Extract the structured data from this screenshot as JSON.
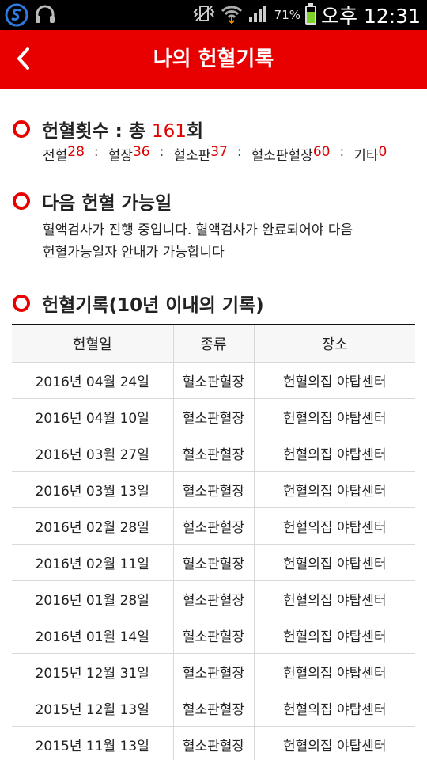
{
  "status_bar": {
    "battery_percent": "71%",
    "battery_level": 0.71,
    "time": "오후 12:31",
    "icons": [
      "s-logo-icon",
      "headset-icon",
      "vibrate-icon",
      "wifi-icon",
      "signal-icon",
      "battery-icon"
    ]
  },
  "header": {
    "title": "나의 헌혈기록",
    "back_icon": "chevron-left-icon",
    "background": "#e80000"
  },
  "summary": {
    "label": "헌혈횟수 : 총 ",
    "total": "161",
    "unit": "회",
    "stats": [
      {
        "label": "전혈",
        "value": "28"
      },
      {
        "label": "혈장",
        "value": "36"
      },
      {
        "label": "혈소판",
        "value": "37"
      },
      {
        "label": "혈소판혈장",
        "value": "60"
      },
      {
        "label": "기타",
        "value": "0"
      }
    ],
    "separator": ":"
  },
  "next": {
    "title": "다음 헌혈 가능일",
    "line1": "혈액검사가 진행 중입니다. 혈액검사가 완료되어야 다음",
    "line2": "헌혈가능일자 안내가 가능합니다"
  },
  "records": {
    "title": "헌혈기록(10년 이내의 기록)",
    "headers": [
      "헌혈일",
      "종류",
      "장소"
    ],
    "rows": [
      [
        "2016년 04월 24일",
        "혈소판혈장",
        "헌혈의집 야탑센터"
      ],
      [
        "2016년 04월 10일",
        "혈소판혈장",
        "헌혈의집 야탑센터"
      ],
      [
        "2016년 03월 27일",
        "혈소판혈장",
        "헌혈의집 야탑센터"
      ],
      [
        "2016년 03월 13일",
        "혈소판혈장",
        "헌혈의집 야탑센터"
      ],
      [
        "2016년 02월 28일",
        "혈소판혈장",
        "헌혈의집 야탑센터"
      ],
      [
        "2016년 02월 11일",
        "혈소판혈장",
        "헌혈의집 야탑센터"
      ],
      [
        "2016년 01월 28일",
        "혈소판혈장",
        "헌혈의집 야탑센터"
      ],
      [
        "2016년 01월 14일",
        "혈소판혈장",
        "헌혈의집 야탑센터"
      ],
      [
        "2015년 12월 31일",
        "혈소판혈장",
        "헌혈의집 야탑센터"
      ],
      [
        "2015년 12월 13일",
        "혈소판혈장",
        "헌혈의집 야탑센터"
      ],
      [
        "2015년 11월 13일",
        "혈소판혈장",
        "헌혈의집 야탑센터"
      ]
    ]
  },
  "colors": {
    "accent": "#e80000",
    "highlight": "#e00000"
  }
}
